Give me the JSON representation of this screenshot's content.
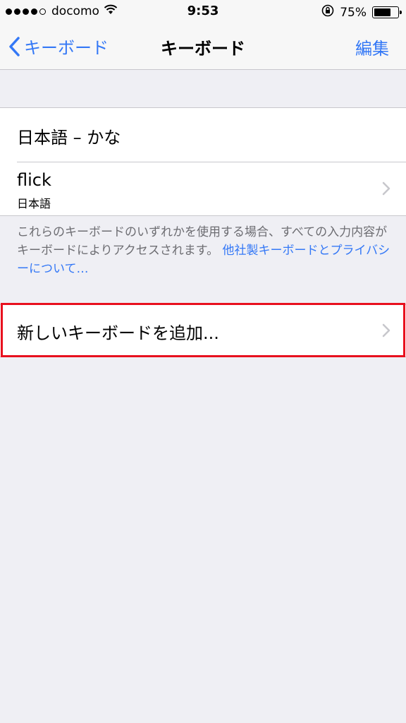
{
  "status_bar": {
    "carrier": "docomo",
    "time": "9:53",
    "battery_percent": "75%",
    "battery_level": 0.75
  },
  "nav": {
    "back_label": "キーボード",
    "title": "キーボード",
    "edit_label": "編集"
  },
  "keyboards": [
    {
      "title": "日本語 – かな"
    },
    {
      "title": "flick",
      "subtitle": "日本語"
    }
  ],
  "footer": {
    "text": "これらのキーボードのいずれかを使用する場合、すべての入力内容がキーボードによりアクセスされます。",
    "link": "他社製キーボードとプライバシーについて…"
  },
  "add_keyboard": {
    "label": "新しいキーボードを追加..."
  },
  "colors": {
    "accent": "#3478f6",
    "highlight": "#e8101e",
    "background": "#efeff4"
  },
  "icons": [
    "wifi-icon",
    "orientation-lock-icon",
    "battery-icon",
    "back-chevron-icon",
    "chevron-right-icon"
  ]
}
